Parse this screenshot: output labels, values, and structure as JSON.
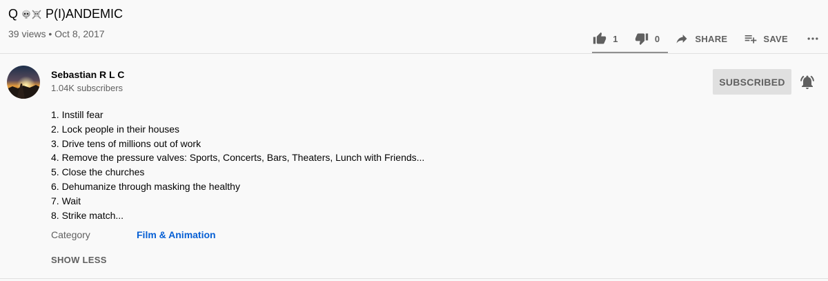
{
  "video": {
    "title_prefix": "Q ",
    "title_main": "P(I)ANDEMIC",
    "title_icons": [
      "skull-icon",
      "skull-crossbones-icon"
    ],
    "views": "39 views",
    "separator": "•",
    "date": "Oct 8, 2017"
  },
  "actions": {
    "like_count": "1",
    "dislike_count": "0",
    "share_label": "SHARE",
    "save_label": "SAVE",
    "more_icon": "more-horiz-icon"
  },
  "owner": {
    "name": "Sebastian R L C",
    "subscribers": "1.04K subscribers",
    "subscribe_label": "SUBSCRIBED"
  },
  "description": {
    "lines": [
      "1. Instill fear",
      "2. Lock people in their houses",
      "3. Drive tens of millions out of work",
      "4. Remove the pressure valves: Sports, Concerts, Bars, Theaters, Lunch with Friends...",
      "5. Close the churches",
      "6. Dehumanize through masking the healthy",
      "7. Wait",
      "8. Strike match..."
    ]
  },
  "metadata": {
    "category_label": "Category",
    "category_value": "Film & Animation",
    "show_less_label": "SHOW LESS"
  },
  "colors": {
    "background": "#f9f9f9",
    "text_primary": "#030303",
    "text_secondary": "#606060",
    "link": "#065fd4",
    "button_subscribed_bg": "#e0e0e0"
  }
}
